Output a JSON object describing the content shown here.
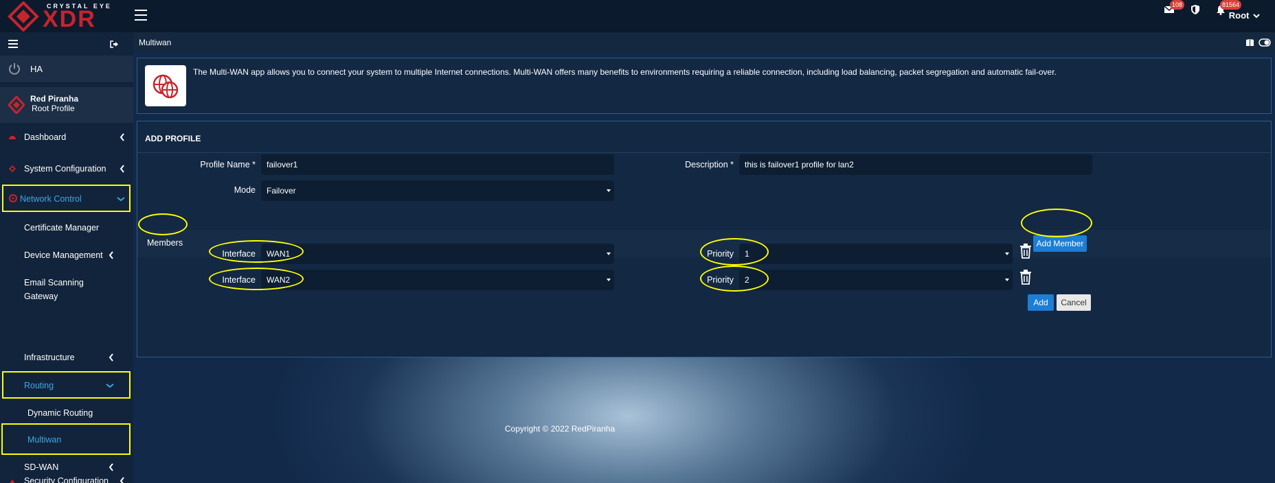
{
  "app": {
    "brand_top": "CRYSTAL EYE",
    "brand_main": "XDR"
  },
  "topbar": {
    "mail_count": "108",
    "alert_count": "81564",
    "user_label": "Root"
  },
  "sidebar": {
    "ha_label": "HA",
    "profile_name": "Red Piranha",
    "profile_sub": "Root Profile",
    "items": [
      {
        "label": "Dashboard"
      },
      {
        "label": "System Configuration"
      },
      {
        "label": "Network Control"
      }
    ],
    "network_sub": [
      {
        "label": "Certificate Manager"
      },
      {
        "label": "Device Management"
      },
      {
        "label": "Email Scanning Gateway"
      },
      {
        "label": "Infrastructure"
      },
      {
        "label": "Routing"
      }
    ],
    "routing_sub": [
      {
        "label": "Dynamic Routing"
      },
      {
        "label": "Multiwan"
      }
    ],
    "sdwan_label": "SD-WAN",
    "security_label": "Security Configuration"
  },
  "main": {
    "page_title": "Multiwan",
    "info_text": "The Multi-WAN app allows you to connect your system to multiple Internet connections. Multi-WAN offers many benefits to environments requiring a reliable connection, including load balancing, packet segregation and automatic fail-over.",
    "form": {
      "title": "ADD PROFILE",
      "profile_name_label": "Profile Name *",
      "profile_name_value": "failover1",
      "description_label": "Description *",
      "description_value": "this is failover1 profile for lan2",
      "mode_label": "Mode",
      "mode_value": "Failover",
      "members_label": "Members",
      "add_member_label": "Add Member",
      "members": [
        {
          "interface_label": "Interface",
          "interface_value": "WAN1",
          "priority_label": "Priority",
          "priority_value": "1"
        },
        {
          "interface_label": "Interface",
          "interface_value": "WAN2",
          "priority_label": "Priority",
          "priority_value": "2"
        }
      ],
      "add_label": "Add",
      "cancel_label": "Cancel"
    },
    "copyright": "Copyright © 2022 RedPiranha"
  },
  "colors": {
    "accent_red": "#c8242b",
    "accent_blue": "#1c7ed6",
    "highlight_yellow": "#ffff00",
    "active_text": "#3ea7e6"
  }
}
